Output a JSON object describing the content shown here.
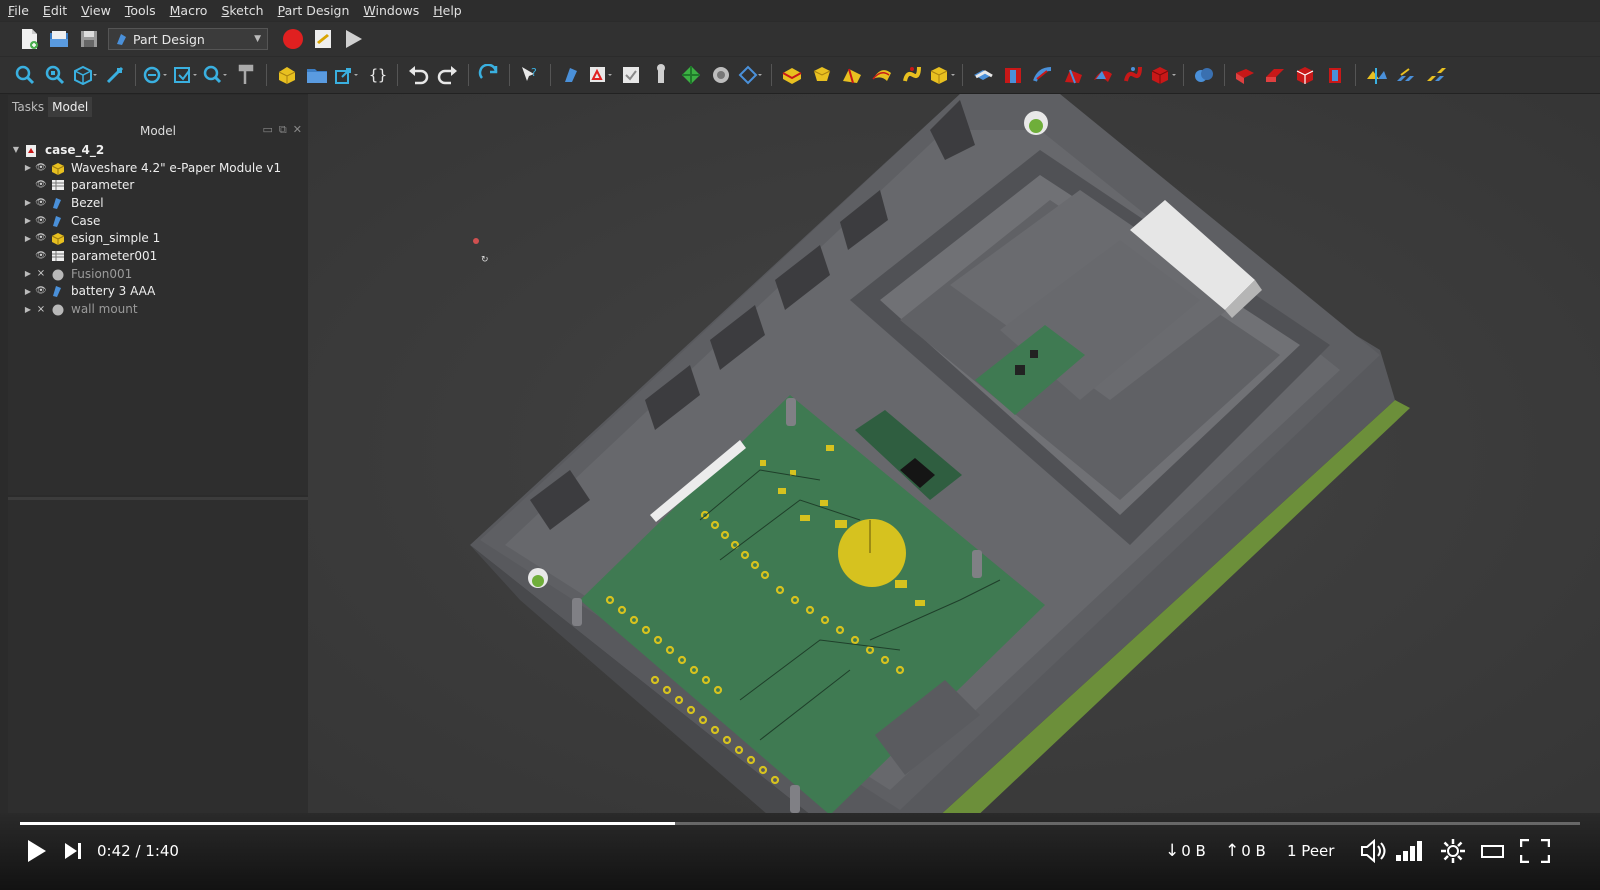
{
  "menu": [
    "File",
    "Edit",
    "View",
    "Tools",
    "Macro",
    "Sketch",
    "Part Design",
    "Windows",
    "Help"
  ],
  "workbench": {
    "label": "Part Design"
  },
  "panel": {
    "tabs": [
      "Tasks",
      "Model"
    ],
    "active_tab": "Model",
    "header": "Model",
    "tree": [
      {
        "label": "case_4_2",
        "level": 0,
        "expanded": true,
        "eye": false,
        "icon": "document-icon",
        "dim": false
      },
      {
        "label": "Waveshare 4.2\" e-Paper Module v1",
        "level": 1,
        "expandable": true,
        "eye": true,
        "icon": "part-icon",
        "dim": false
      },
      {
        "label": "parameter",
        "level": 1,
        "expandable": false,
        "eye": true,
        "icon": "spreadsheet-icon",
        "dim": false
      },
      {
        "label": "Bezel",
        "level": 1,
        "expandable": true,
        "eye": true,
        "icon": "body-icon",
        "dim": false
      },
      {
        "label": "Case",
        "level": 1,
        "expandable": true,
        "eye": true,
        "icon": "body-icon",
        "dim": false
      },
      {
        "label": "esign_simple 1",
        "level": 1,
        "expandable": true,
        "eye": true,
        "icon": "part-icon",
        "dim": false
      },
      {
        "label": "parameter001",
        "level": 1,
        "expandable": false,
        "eye": true,
        "icon": "spreadsheet-icon",
        "dim": false
      },
      {
        "label": "Fusion001",
        "level": 1,
        "expandable": true,
        "eye": false,
        "icon": "fusion-icon",
        "dim": true
      },
      {
        "label": "battery 3 AAA",
        "level": 1,
        "expandable": true,
        "eye": true,
        "icon": "body-icon",
        "dim": false
      },
      {
        "label": "wall mount",
        "level": 1,
        "expandable": true,
        "eye": false,
        "icon": "fusion-icon",
        "dim": true
      }
    ]
  },
  "video": {
    "time": "0:42 / 1:40",
    "progress": 0.42,
    "down": "0 B",
    "up": "0 B",
    "peers": "1 Peer"
  },
  "colors": {
    "accent": "#4a90d9",
    "record": "#e02020",
    "pcb": "#3f7a52",
    "pad": "#d6c21f",
    "case": "#5a5a5e",
    "green_edge": "#6c8f3a"
  }
}
